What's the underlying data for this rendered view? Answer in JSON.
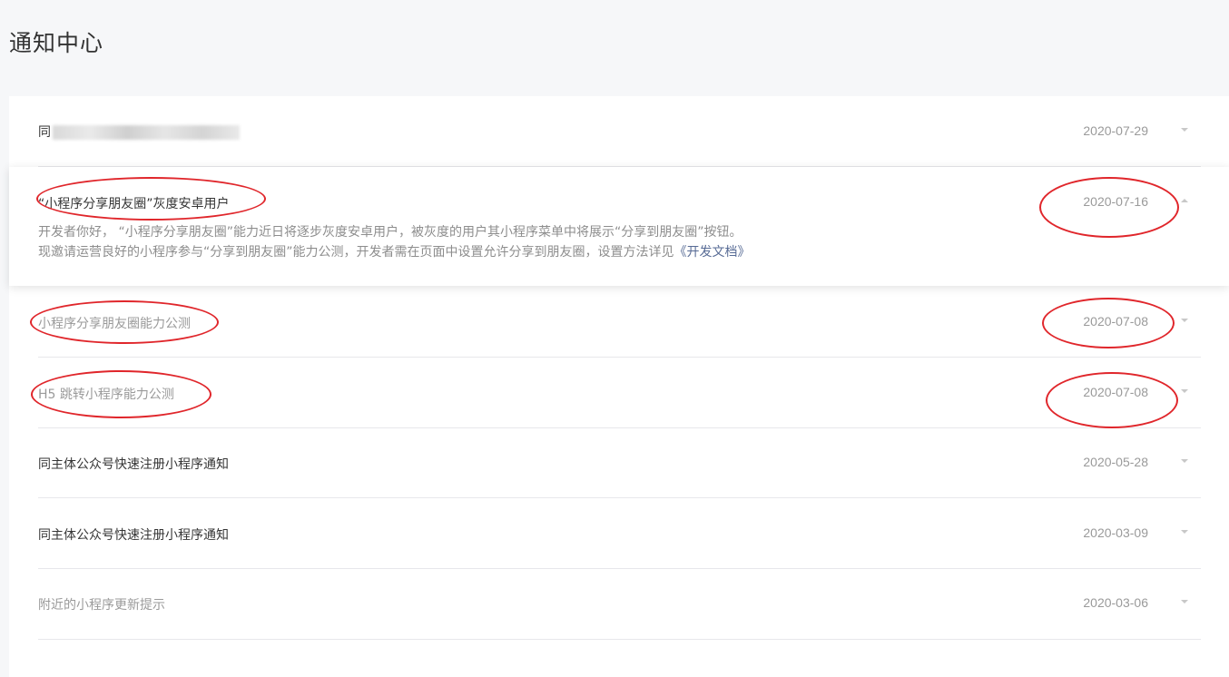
{
  "page": {
    "title": "通知中心"
  },
  "notices": [
    {
      "title": "同",
      "date": "2020-07-29",
      "state": "unread",
      "blurred": true
    },
    {
      "title": "“小程序分享朋友圈”灰度安卓用户",
      "date": "2020-07-16",
      "state": "expanded",
      "body_line1": "开发者你好， “小程序分享朋友圈”能力近日将逐步灰度安卓用户，被灰度的用户其小程序菜单中将展示“分享到朋友圈”按钮。",
      "body_line2_prefix": "现邀请运营良好的小程序参与“分享到朋友圈”能力公测，开发者需在页面中设置允许分享到朋友圈，设置方法详见",
      "body_link": "《开发文档》"
    },
    {
      "title": "小程序分享朋友圈能力公测",
      "date": "2020-07-08",
      "state": "read"
    },
    {
      "title": "H5 跳转小程序能力公测",
      "date": "2020-07-08",
      "state": "read"
    },
    {
      "title": "同主体公众号快速注册小程序通知",
      "date": "2020-05-28",
      "state": "unread"
    },
    {
      "title": "同主体公众号快速注册小程序通知",
      "date": "2020-03-09",
      "state": "unread"
    },
    {
      "title": "附近的小程序更新提示",
      "date": "2020-03-06",
      "state": "read"
    }
  ],
  "annotation_color": "#e0262b"
}
